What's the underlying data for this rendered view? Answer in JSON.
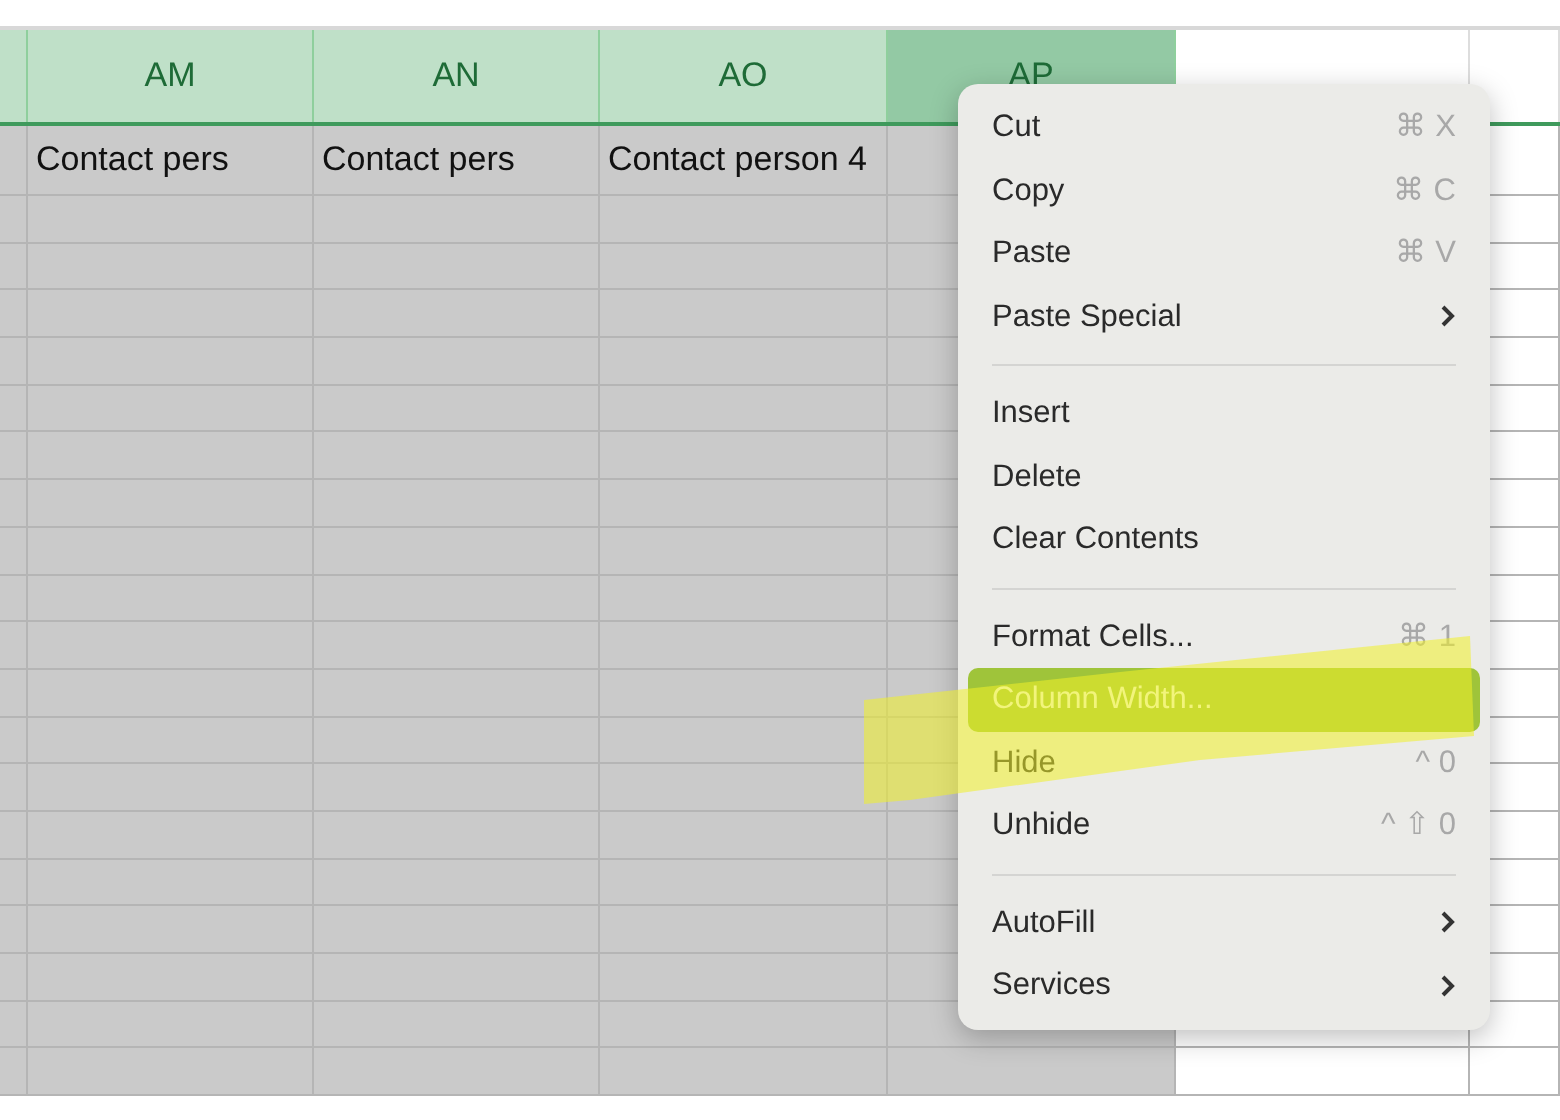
{
  "columns": [
    {
      "selected": true,
      "active": false
    },
    {
      "label": "AM",
      "selected": true,
      "active": false,
      "row_1": "Contact pers"
    },
    {
      "label": "AN",
      "selected": true,
      "active": false,
      "row_1": "Contact pers"
    },
    {
      "label": "AO",
      "selected": true,
      "active": false,
      "row_1": "Contact person 4"
    },
    {
      "label": "AP",
      "selected": true,
      "active": true
    },
    {
      "selected": false,
      "active": false
    },
    {
      "selected": false,
      "active": false
    }
  ],
  "context_menu": {
    "sections": [
      [
        {
          "label": "Cut",
          "shortcut": "⌘ X",
          "submenu": false,
          "selected": false
        },
        {
          "label": "Copy",
          "shortcut": "⌘ C",
          "submenu": false,
          "selected": false
        },
        {
          "label": "Paste",
          "shortcut": "⌘ V",
          "submenu": false,
          "selected": false
        },
        {
          "label": "Paste Special",
          "submenu": true,
          "selected": false
        }
      ],
      [
        {
          "label": "Insert",
          "submenu": false,
          "selected": false
        },
        {
          "label": "Delete",
          "submenu": false,
          "selected": false
        },
        {
          "label": "Clear Contents",
          "submenu": false,
          "selected": false
        }
      ],
      [
        {
          "label": "Format Cells...",
          "shortcut": "⌘ 1",
          "submenu": false,
          "selected": false
        },
        {
          "label": "Column Width...",
          "submenu": false,
          "selected": true
        },
        {
          "label": "Hide",
          "shortcut": "^ 0",
          "submenu": false,
          "selected": false
        },
        {
          "label": "Unhide",
          "shortcut": "^ ⇧ 0",
          "submenu": false,
          "selected": false
        }
      ],
      [
        {
          "label": "AutoFill",
          "submenu": true,
          "selected": false
        },
        {
          "label": "Services",
          "submenu": true,
          "selected": false
        }
      ]
    ]
  }
}
